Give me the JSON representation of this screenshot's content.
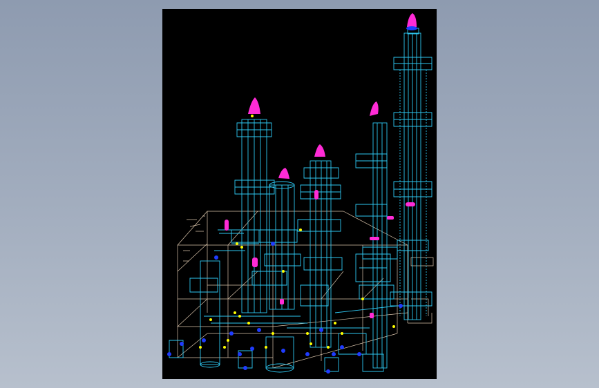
{
  "viewer": {
    "background": "#000000",
    "colors": {
      "pipe": "#2ec8f2",
      "equipment": "#2ec8f2",
      "vent_stack": "#ff2bd6",
      "steel_frame": "#ffe6c8",
      "fittings": "#ffff00",
      "valves": "#1f3cff"
    }
  },
  "model": {
    "type": "3d-wireframe-process-plant",
    "columns": [
      {
        "id": "column-a",
        "has_vent": true,
        "platforms": 3
      },
      {
        "id": "column-b",
        "has_vent": true,
        "platforms": 2
      },
      {
        "id": "column-c",
        "has_vent": true,
        "platforms": 3
      },
      {
        "id": "column-d",
        "has_vent": true,
        "platforms": 4
      },
      {
        "id": "column-e",
        "has_vent": true,
        "platforms": 5
      }
    ]
  }
}
